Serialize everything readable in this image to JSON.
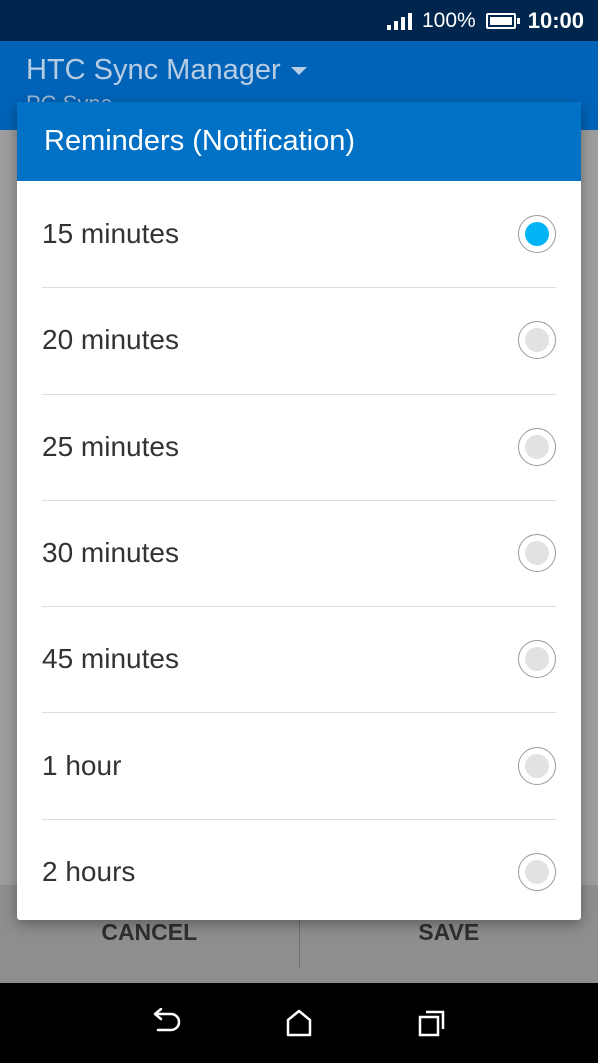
{
  "status_bar": {
    "battery_text": "100%",
    "time": "10:00"
  },
  "app_bar": {
    "title": "HTC Sync Manager",
    "subtitle": "PC Sync"
  },
  "bottom_actions": {
    "cancel_label": "CANCEL",
    "save_label": "SAVE"
  },
  "dialog": {
    "title": "Reminders (Notification)",
    "options": [
      {
        "label": "15 minutes",
        "selected": true
      },
      {
        "label": "20 minutes",
        "selected": false
      },
      {
        "label": "25 minutes",
        "selected": false
      },
      {
        "label": "30 minutes",
        "selected": false
      },
      {
        "label": "45 minutes",
        "selected": false
      },
      {
        "label": "1 hour",
        "selected": false
      },
      {
        "label": "2 hours",
        "selected": false
      }
    ]
  },
  "nav_bar": {
    "icons": [
      "back-icon",
      "home-icon",
      "recents-icon"
    ]
  },
  "colors": {
    "header": "#0071c5",
    "selected_radio": "#00b4f5",
    "status_bar": "#00264d"
  }
}
